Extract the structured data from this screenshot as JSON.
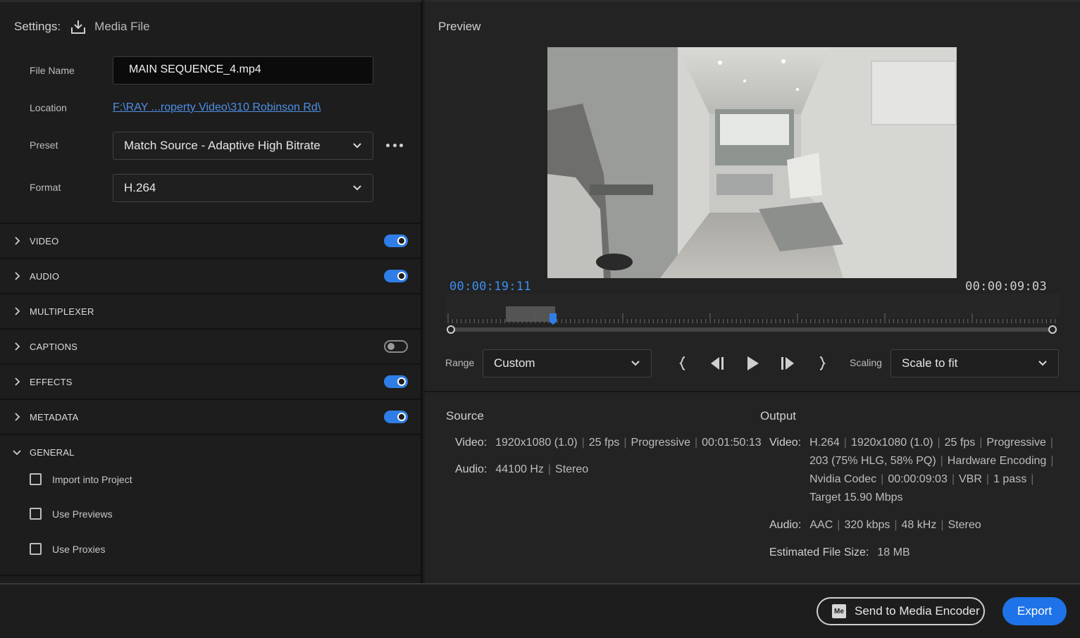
{
  "settings": {
    "label": "Settings:",
    "mode": "Media File",
    "file_name_label": "File Name",
    "file_name_value": "MAIN SEQUENCE_4.mp4",
    "location_label": "Location",
    "location_value": "F:\\RAY ...roperty Video\\310 Robinson Rd\\",
    "preset_label": "Preset",
    "preset_value": "Match Source - Adaptive High Bitrate",
    "format_label": "Format",
    "format_value": "H.264"
  },
  "sections": [
    {
      "label": "VIDEO",
      "toggle": "on"
    },
    {
      "label": "AUDIO",
      "toggle": "on"
    },
    {
      "label": "MULTIPLEXER",
      "toggle": "none"
    },
    {
      "label": "CAPTIONS",
      "toggle": "off"
    },
    {
      "label": "EFFECTS",
      "toggle": "on"
    },
    {
      "label": "METADATA",
      "toggle": "on"
    },
    {
      "label": "GENERAL",
      "toggle": "none",
      "expanded": true
    }
  ],
  "general": {
    "options": [
      {
        "label": "Import into Project",
        "checked": false
      },
      {
        "label": "Use Previews",
        "checked": false
      },
      {
        "label": "Use Proxies",
        "checked": false
      }
    ]
  },
  "preview": {
    "title": "Preview",
    "timecode_current": "00:00:19:11",
    "timecode_duration": "00:00:09:03",
    "range_label": "Range",
    "range_value": "Custom",
    "scaling_label": "Scaling",
    "scaling_value": "Scale to fit"
  },
  "source": {
    "title": "Source",
    "video_label": "Video:",
    "video_parts": [
      "1920x1080 (1.0)",
      "25 fps",
      "Progressive",
      "00:01:50:13"
    ],
    "audio_label": "Audio:",
    "audio_parts": [
      "44100 Hz",
      "Stereo"
    ]
  },
  "output": {
    "title": "Output",
    "video_label": "Video:",
    "video_line1": [
      "H.264",
      "1920x1080 (1.0)",
      "25 fps",
      "Progressive"
    ],
    "video_line2": [
      "203 (75% HLG, 58% PQ)",
      "Hardware Encoding"
    ],
    "video_line3": [
      "Nvidia Codec",
      "00:00:09:03",
      "VBR",
      "1 pass"
    ],
    "video_line4": "Target 15.90 Mbps",
    "audio_label": "Audio:",
    "audio_parts": [
      "AAC",
      "320 kbps",
      "48 kHz",
      "Stereo"
    ],
    "filesize_label": "Estimated File Size:",
    "filesize_value": "18 MB"
  },
  "footer": {
    "media_encoder_icon": "Me",
    "send_label": "Send to Media Encoder",
    "export_label": "Export"
  },
  "colors": {
    "accent": "#1f73e8",
    "timecode": "#3d8ef0",
    "link": "#4d8fe6"
  }
}
